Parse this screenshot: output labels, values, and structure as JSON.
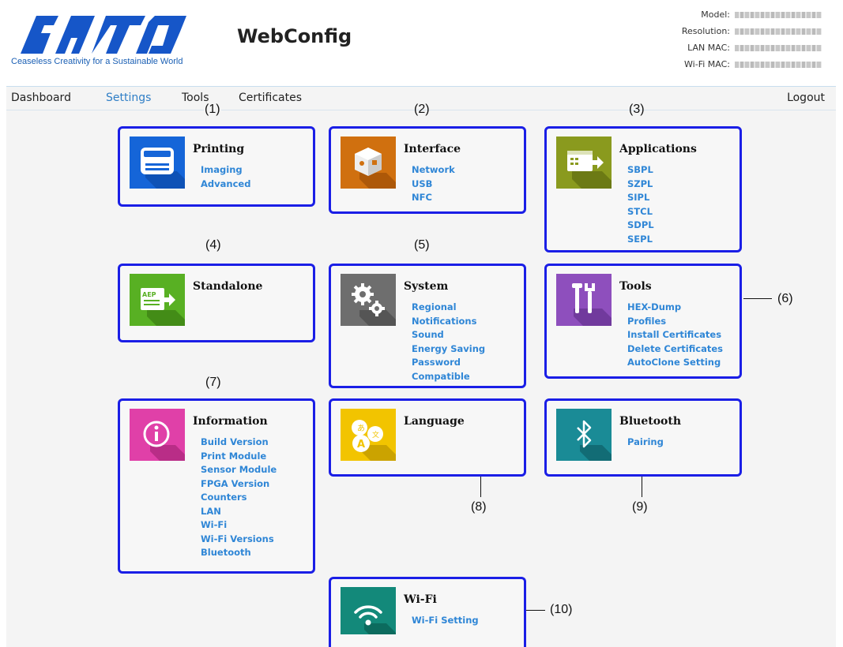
{
  "header": {
    "logo_text": "SATO",
    "tagline": "Ceaseless Creativity for a Sustainable World",
    "app_title": "WebConfig",
    "info": [
      {
        "label": "Model:"
      },
      {
        "label": "Resolution:"
      },
      {
        "label": "LAN MAC:"
      },
      {
        "label": "Wi-Fi MAC:"
      }
    ]
  },
  "nav": {
    "items": [
      {
        "label": "Dashboard"
      },
      {
        "label": "Settings"
      },
      {
        "label": "Tools"
      },
      {
        "label": "Certificates"
      }
    ],
    "logout": "Logout",
    "active": "Settings"
  },
  "callouts": [
    "(1)",
    "(2)",
    "(3)",
    "(4)",
    "(5)",
    "(6)",
    "(7)",
    "(8)",
    "(9)",
    "(10)"
  ],
  "cards": {
    "printing": {
      "title": "Printing",
      "links": [
        "Imaging",
        "Advanced"
      ],
      "icon": "printer-icon",
      "color": "#1565d8"
    },
    "interface": {
      "title": "Interface",
      "links": [
        "Network",
        "USB",
        "NFC"
      ],
      "icon": "interface-cube-icon",
      "color": "#d0700f"
    },
    "applications": {
      "title": "Applications",
      "links": [
        "SBPL",
        "SZPL",
        "SIPL",
        "STCL",
        "SDPL",
        "SEPL"
      ],
      "icon": "applications-icon",
      "color": "#8a9a1e"
    },
    "standalone": {
      "title": "Standalone",
      "links": [],
      "icon": "standalone-aep-icon",
      "color": "#58b023"
    },
    "system": {
      "title": "System",
      "links": [
        "Regional",
        "Notifications",
        "Sound",
        "Energy Saving",
        "Password",
        "Compatible"
      ],
      "icon": "gears-icon",
      "color": "#6e6e6e"
    },
    "tools": {
      "title": "Tools",
      "links": [
        "HEX-Dump",
        "Profiles",
        "Install Certificates",
        "Delete Certificates",
        "AutoClone Setting"
      ],
      "icon": "tools-icon",
      "color": "#8e4fbd"
    },
    "information": {
      "title": "Information",
      "links": [
        "Build Version",
        "Print Module",
        "Sensor Module",
        "FPGA Version",
        "Counters",
        "LAN",
        "Wi-Fi",
        "Wi-Fi Versions",
        "Bluetooth"
      ],
      "icon": "info-icon",
      "color": "#e040a8"
    },
    "language": {
      "title": "Language",
      "links": [],
      "icon": "language-icon",
      "color": "#f2c400"
    },
    "bluetooth": {
      "title": "Bluetooth",
      "links": [
        "Pairing"
      ],
      "icon": "bluetooth-icon",
      "color": "#1a8b96"
    },
    "wifi": {
      "title": "Wi-Fi",
      "links": [
        "Wi-Fi Setting"
      ],
      "icon": "wifi-icon",
      "color": "#13897a"
    }
  }
}
